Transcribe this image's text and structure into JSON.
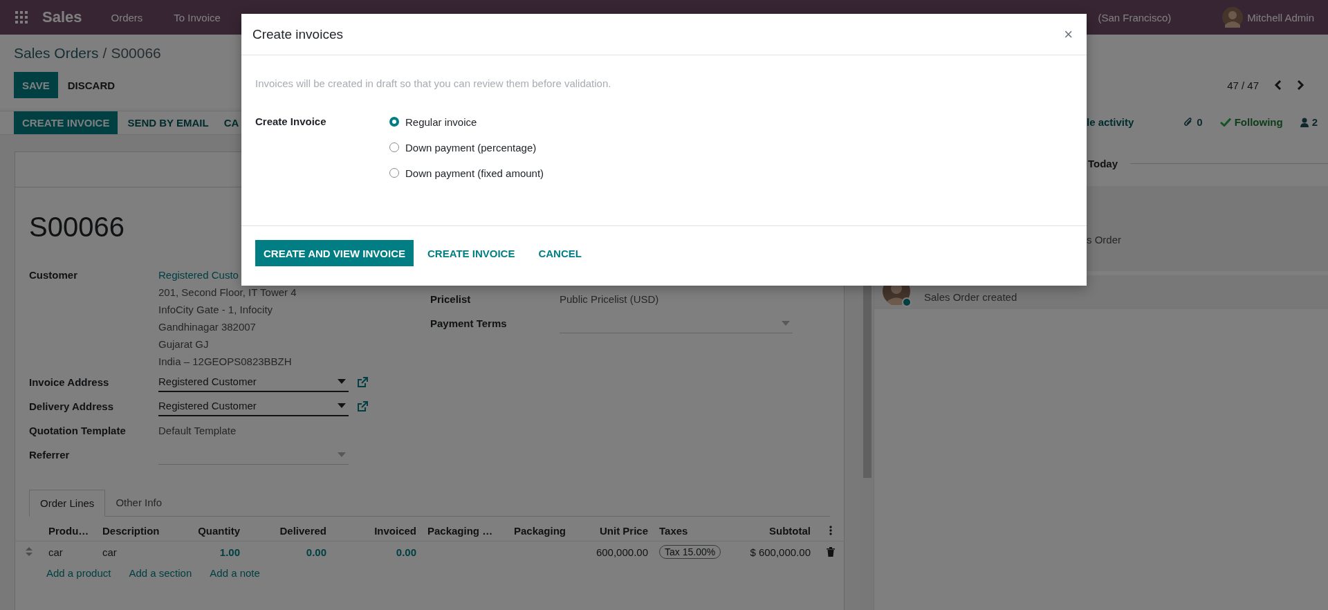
{
  "navbar": {
    "app_name": "Sales",
    "menu": [
      "Orders",
      "To Invoice"
    ],
    "company": "(San Francisco)",
    "user": "Mitchell Admin"
  },
  "breadcrumb": {
    "items": [
      "Sales Orders",
      "S00066"
    ],
    "separator": "/"
  },
  "form_buttons": [
    {
      "label": "SAVE",
      "primary": true
    },
    {
      "label": "DISCARD",
      "primary": false
    }
  ],
  "pager": "47 / 47",
  "action_buttons": [
    {
      "label": "CREATE INVOICE",
      "primary": true
    },
    {
      "label": "SEND BY EMAIL",
      "primary": false
    },
    {
      "label": "CA",
      "primary": false
    }
  ],
  "record": {
    "name": "S00066",
    "left_fields": [
      {
        "kind": "address",
        "label": "Customer",
        "lines": [
          "Registered Custo",
          "201, Second Floor, IT Tower 4",
          "InfoCity Gate - 1, Infocity",
          "Gandhinagar 382007",
          "Gujarat GJ",
          "India – 12GEOPS0823BBZH"
        ]
      },
      {
        "kind": "select",
        "label": "Invoice Address",
        "value": "Registered Customer",
        "required": true,
        "link": true
      },
      {
        "kind": "select",
        "label": "Delivery Address",
        "value": "Registered Customer",
        "required": true,
        "link": true
      },
      {
        "kind": "text",
        "label": "Quotation Template",
        "value": "Default Template"
      },
      {
        "kind": "select",
        "label": "Referrer",
        "required": false,
        "link": false
      }
    ],
    "right_fields": [
      {
        "kind": "text",
        "label": "Pricelist",
        "value": "Public Pricelist (USD)"
      },
      {
        "kind": "select",
        "label": "Payment Terms",
        "required": false,
        "link": false
      }
    ]
  },
  "tabs": [
    {
      "label": "Order Lines",
      "selected": true
    },
    {
      "label": "Other Info",
      "selected": false
    }
  ],
  "order_lines": {
    "columns": [
      "Produ…",
      "Description",
      "Quantity",
      "Delivered",
      "Invoiced",
      "Packaging …",
      "Packaging",
      "Unit Price",
      "Taxes",
      "Subtotal"
    ],
    "rows": [
      {
        "product": "car",
        "description": "car",
        "quantity": "1.00",
        "delivered": "0.00",
        "invoiced": "0.00",
        "unit_price": "600,000.00",
        "taxes": [
          "Tax 15.00%"
        ],
        "subtotal": "$ 600,000.00"
      }
    ],
    "add_links": [
      "Add a product",
      "Add a section",
      "Add a note"
    ]
  },
  "chatter": {
    "activity": "le activity",
    "attachments": "0",
    "following": "Following",
    "followers": "2",
    "date_separator": "Today",
    "messages": [
      {
        "text": "s Order"
      },
      {
        "text": "Sales Order created",
        "avatar": true,
        "online": true
      }
    ]
  },
  "dialog": {
    "title": "Create invoices",
    "close": "×",
    "hint": "Invoices will be created in draft so that you can review them before validation.",
    "field_label": "Create Invoice",
    "options": [
      {
        "label": "Regular invoice",
        "selected": true
      },
      {
        "label": "Down payment (percentage)",
        "selected": false
      },
      {
        "label": "Down payment (fixed amount)",
        "selected": false
      }
    ],
    "buttons": [
      {
        "label": "CREATE AND VIEW INVOICE",
        "primary": true
      },
      {
        "label": "CREATE INVOICE",
        "primary": false
      },
      {
        "label": "CANCEL",
        "primary": false
      }
    ]
  }
}
